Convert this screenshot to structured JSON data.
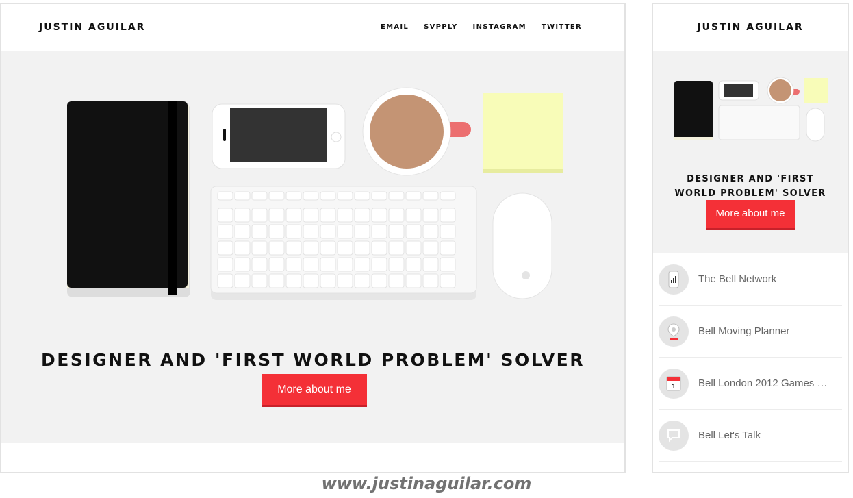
{
  "desktop": {
    "brand": "JUSTIN AGUILAR",
    "nav": [
      "EMAIL",
      "SVPPLY",
      "INSTAGRAM",
      "TWITTER"
    ],
    "hero": {
      "headline": "DESIGNER AND 'FIRST WORLD PROBLEM' SOLVER",
      "cta_label": "More about me",
      "illustration_items": [
        "notebook-icon",
        "phone-icon",
        "coffee-cup-icon",
        "sticky-note-icon",
        "keyboard-icon",
        "mouse-icon"
      ]
    }
  },
  "mobile": {
    "brand": "JUSTIN AGUILAR",
    "hero": {
      "headline": "DESIGNER AND 'FIRST WORLD PROBLEM' SOLVER",
      "cta_label": "More about me"
    },
    "projects": [
      {
        "label": "The Bell Network",
        "icon": "phone-signal-icon"
      },
      {
        "label": "Bell Moving Planner",
        "icon": "map-pin-icon"
      },
      {
        "label": "Bell London 2012 Games S…",
        "icon": "calendar-icon",
        "icon_text": "1"
      },
      {
        "label": "Bell Let's Talk",
        "icon": "speech-bubble-icon"
      }
    ]
  },
  "footer_url": "www.justinaguilar.com",
  "colors": {
    "accent": "#f43037",
    "hero_bg": "#f2f2f2",
    "text": "#111111"
  }
}
